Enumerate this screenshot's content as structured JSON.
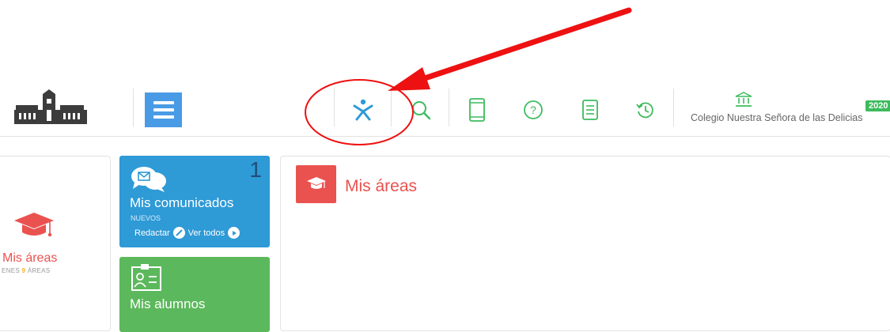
{
  "header": {
    "menu_icon": "hamburger-menu-icon",
    "toolbar_icons": [
      "accessibility-person-icon",
      "search-icon",
      "tablet-icon",
      "help-circle-icon",
      "document-list-icon",
      "history-icon"
    ],
    "school_name": "Colegio Nuestra Señora de las Delicias",
    "year_badge": "2020"
  },
  "sidebar": {
    "title": "Mis áreas",
    "sub_prefix": "ENES",
    "sub_count": "9",
    "sub_suffix": "ÁREAS"
  },
  "cards": {
    "comunicados": {
      "count": "1",
      "title": "Mis comunicados",
      "subtitle": "NUEVOS",
      "compose_label": "Redactar",
      "view_all_label": "Ver todos"
    },
    "alumnos": {
      "title": "Mis alumnos"
    }
  },
  "main": {
    "title": "Mis áreas"
  },
  "colors": {
    "accent_blue": "#4a9be6",
    "card_blue": "#2e9ad6",
    "card_green": "#5cb85c",
    "brand_red": "#e9524f",
    "annotation_red": "#ee1111"
  }
}
